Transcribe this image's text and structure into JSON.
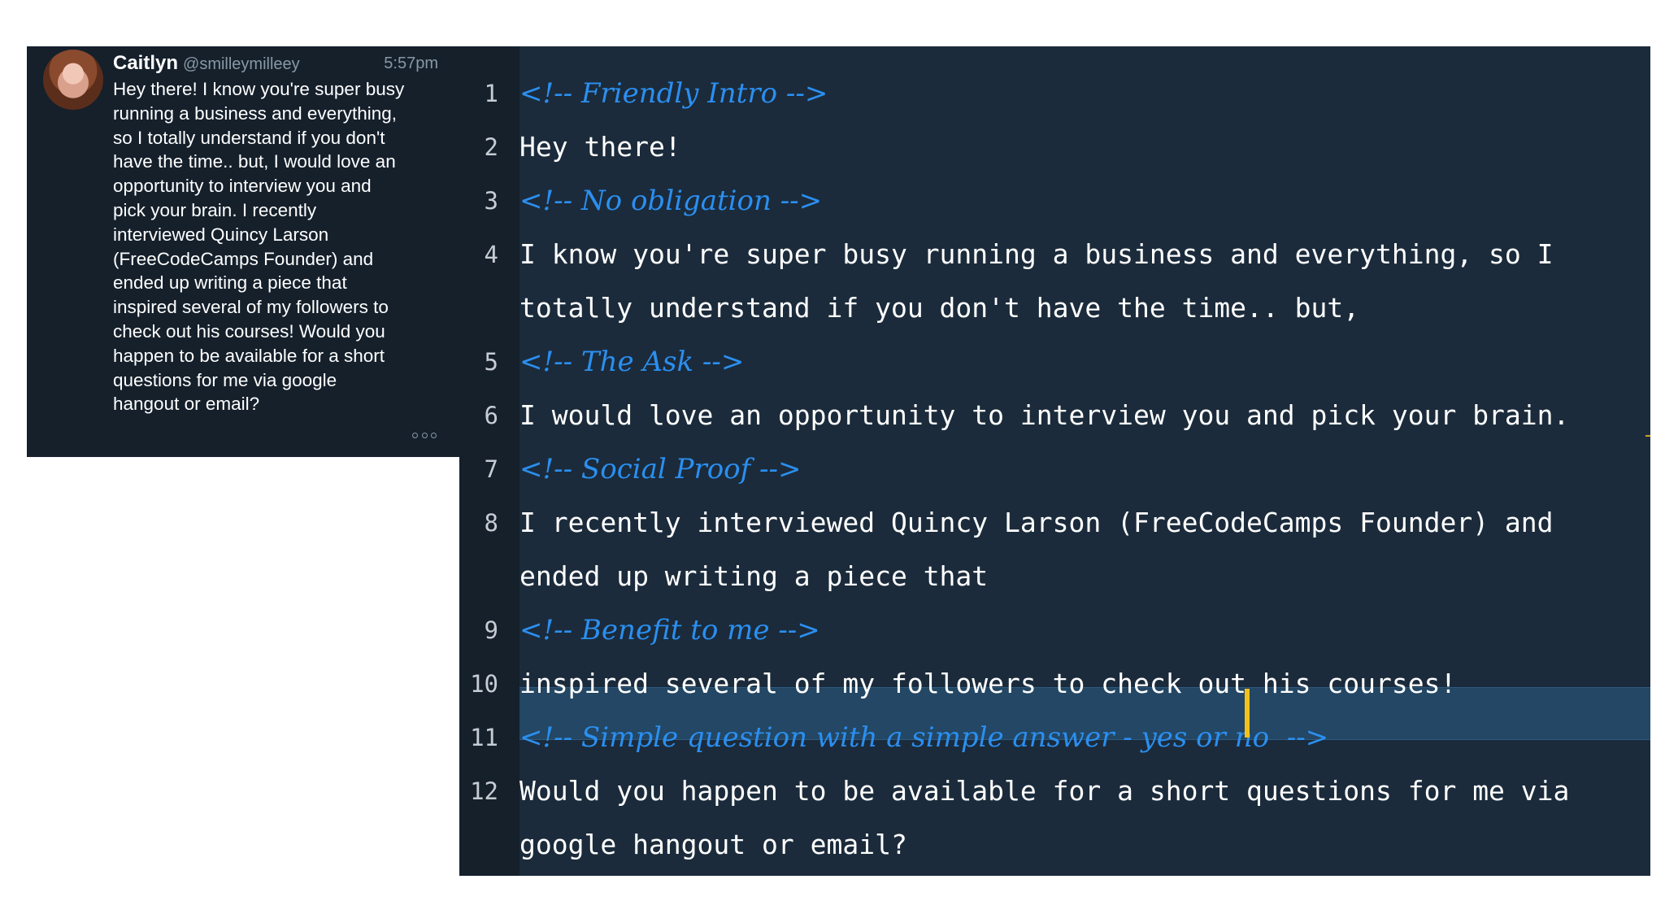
{
  "dm": {
    "name": "Caitlyn",
    "handle": "@smilleymilleey",
    "time": "5:57pm",
    "message": "Hey there! I know you're super busy\nrunning a business and everything,\nso I totally understand if you don't\nhave the time.. but, I would love an\nopportunity to interview you and\npick your brain. I recently\ninterviewed Quincy Larson\n(FreeCodeCamps Founder) and\nended up writing a piece that\ninspired several of my followers to\ncheck out his courses! Would you\nhappen to be available for a short\nquestions for me via google\nhangout or email?"
  },
  "editor": {
    "lines": [
      {
        "num": "1",
        "text": "<!-- Friendly Intro -->",
        "type": "comment"
      },
      {
        "num": "2",
        "text": "Hey there!",
        "type": "code"
      },
      {
        "num": "3",
        "text": "<!-- No obligation -->",
        "type": "comment"
      },
      {
        "num": "4",
        "text": "I know you're super busy running a business and everything, so I",
        "type": "code"
      },
      {
        "num": "",
        "text": "totally understand if you don't have the time.. but,",
        "type": "code"
      },
      {
        "num": "5",
        "text": "<!-- The Ask -->",
        "type": "comment"
      },
      {
        "num": "6",
        "text": "I would love an opportunity to interview you and pick your brain.",
        "type": "code"
      },
      {
        "num": "7",
        "text": "<!-- Social Proof -->",
        "type": "comment"
      },
      {
        "num": "8",
        "text": "I recently interviewed Quincy Larson (FreeCodeCamps Founder) and",
        "type": "code"
      },
      {
        "num": "",
        "text": "ended up writing a piece that",
        "type": "code"
      },
      {
        "num": "9",
        "text": "<!-- Benefit to me -->",
        "type": "comment"
      },
      {
        "num": "10",
        "text": "inspired several of my followers to check out his courses!",
        "type": "code"
      },
      {
        "num": "11",
        "text": "<!-- Simple question with a simple answer - yes or no  -->",
        "type": "comment"
      },
      {
        "num": "12",
        "text": "Would you happen to be available for a short questions for me via",
        "type": "code"
      },
      {
        "num": "",
        "text": "google hangout or email?",
        "type": "code"
      }
    ]
  }
}
